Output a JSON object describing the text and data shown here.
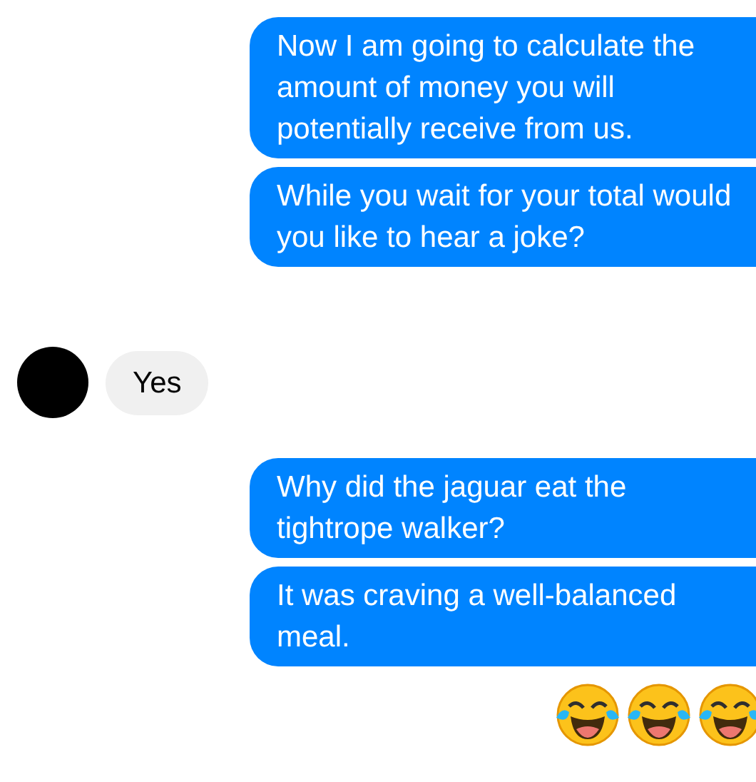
{
  "messages": [
    {
      "kind": "outgoing",
      "text": "Now I am going to calculate the amount of money you will potentially receive from us."
    },
    {
      "kind": "outgoing",
      "text": "While you wait for your total would you like to hear a joke?"
    },
    {
      "kind": "incoming",
      "text": "Yes"
    },
    {
      "kind": "outgoing",
      "text": "Why did the jaguar eat the tightrope walker?"
    },
    {
      "kind": "outgoing",
      "text": "It was craving a well-balanced meal."
    }
  ],
  "reactions": [
    {
      "kind": "laughing"
    },
    {
      "kind": "laughing"
    },
    {
      "kind": "laughing"
    }
  ]
}
